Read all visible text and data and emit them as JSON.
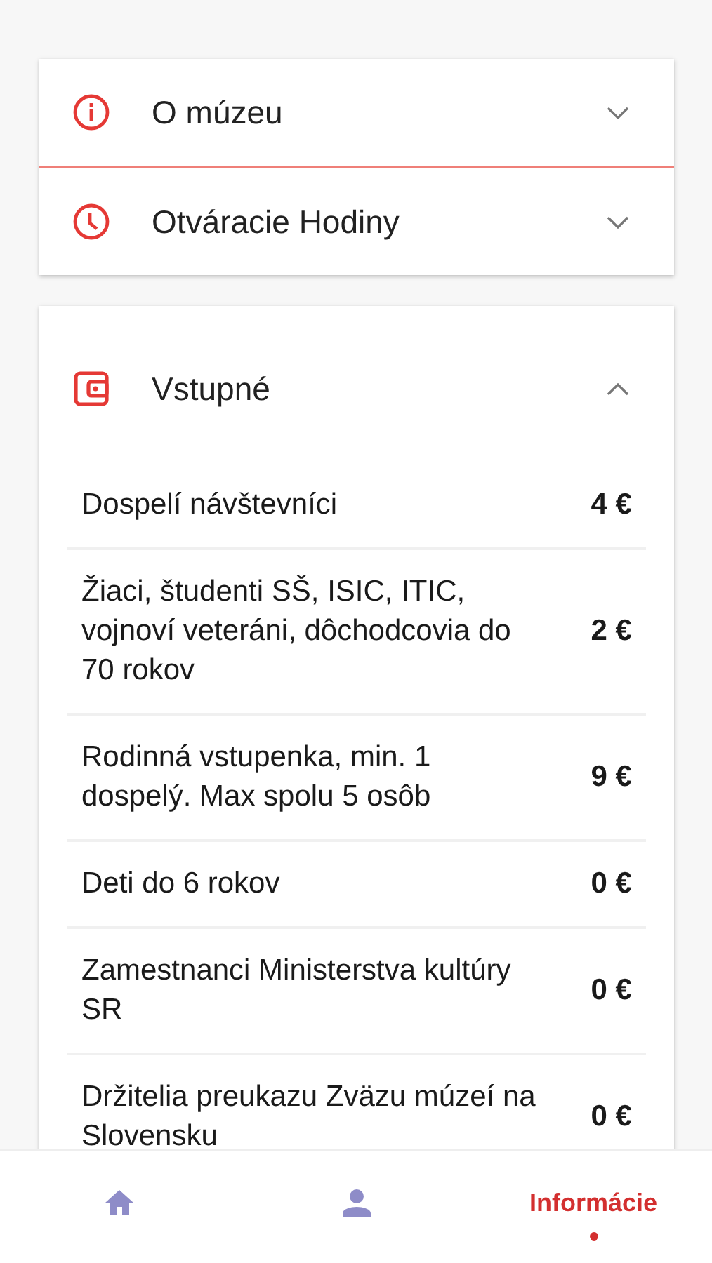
{
  "sections": [
    {
      "kind": "info",
      "title": "O múzeu",
      "expanded": false
    },
    {
      "kind": "clock",
      "title": "Otváracie Hodiny",
      "expanded": false
    },
    {
      "kind": "wallet",
      "title": "Vstupné",
      "expanded": true,
      "prices": [
        {
          "label": "Dospelí návštevníci",
          "price": "4 €"
        },
        {
          "label": "Žiaci, študenti SŠ, ISIC, ITIC, vojnoví veteráni, dôchodcovia do 70 rokov",
          "price": "2 €"
        },
        {
          "label": "Rodinná vstupenka, min. 1 dospelý. Max spolu 5 osôb",
          "price": "9 €"
        },
        {
          "label": "Deti do 6 rokov",
          "price": "0 €"
        },
        {
          "label": "Zamestnanci Ministerstva kultúry SR",
          "price": "0 €"
        },
        {
          "label": "Držitelia preukazu Zväzu múzeí na Slovensku",
          "price": "0 €"
        }
      ]
    }
  ],
  "nav": [
    {
      "kind": "home",
      "selected": false
    },
    {
      "kind": "person",
      "selected": false
    },
    {
      "kind": "label",
      "label": "Informácie",
      "selected": true
    }
  ]
}
